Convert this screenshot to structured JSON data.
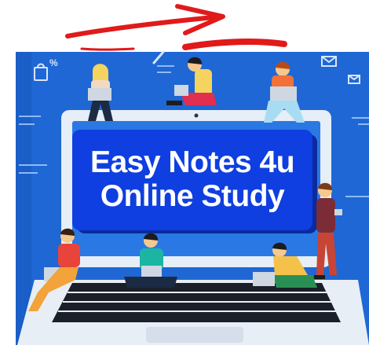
{
  "banner": {
    "line1": "Easy Notes 4u",
    "line2": "Online Study"
  },
  "icons": {
    "annotation": "red-arrow-icon",
    "bag": "shopping-bag-percent-icon",
    "mail": "envelope-icon",
    "pen": "pen-icon"
  },
  "colors": {
    "background_blue": "#1f67d4",
    "banner_blue": "#0f3fe0",
    "banner_shadow": "#0a2a9e",
    "laptop_frame": "#e6eef7",
    "keyboard": "#1b1f2a",
    "annotation_red": "#e11a1a"
  }
}
